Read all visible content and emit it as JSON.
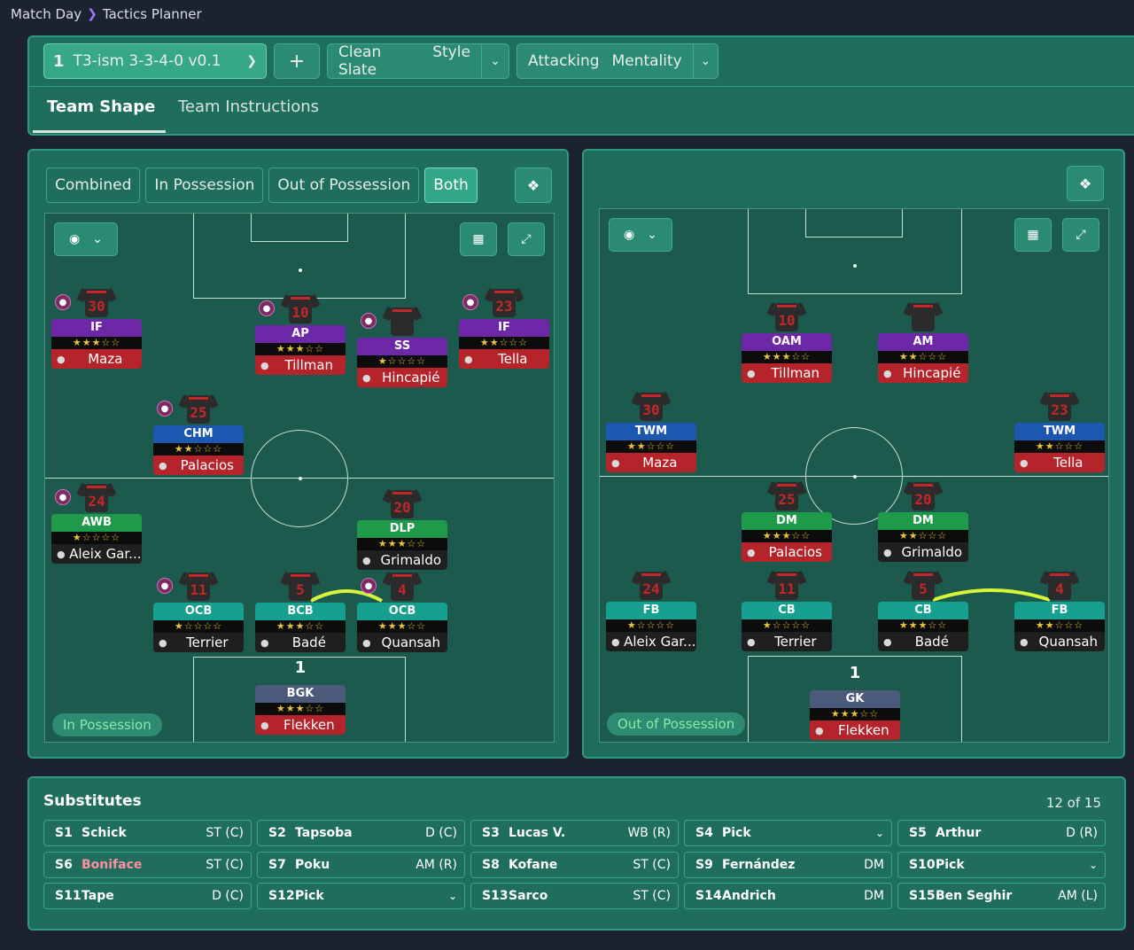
{
  "breadcrumb": {
    "root": "Match Day",
    "current": "Tactics Planner"
  },
  "toolbar": {
    "tactic_num": "1",
    "tactic_name": "T3-ism 3-3-4-0 v0.1",
    "add_label": "+",
    "style_value": "Clean Slate",
    "style_label": "Style",
    "mentality_value": "Attacking",
    "mentality_label": "Mentality"
  },
  "tabs": {
    "team_shape": "Team Shape",
    "team_instructions": "Team Instructions"
  },
  "view_toggle": {
    "combined": "Combined",
    "in_possession": "In Possession",
    "out_of_possession": "Out of Possession",
    "both": "Both"
  },
  "left_pitch": {
    "phase_label": "In Possession",
    "players": [
      {
        "role": "IF",
        "stars": "★★★☆☆",
        "name": "Maza",
        "shirt": "30"
      },
      {
        "role": "AP",
        "stars": "★★★☆☆",
        "name": "Tillman",
        "shirt": "10"
      },
      {
        "role": "SS",
        "stars": "★☆☆☆☆",
        "name": "Hincapié",
        "shirt": ""
      },
      {
        "role": "IF",
        "stars": "★★☆☆☆",
        "name": "Tella",
        "shirt": "23"
      },
      {
        "role": "CHM",
        "stars": "★★☆☆☆",
        "name": "Palacios",
        "shirt": "25"
      },
      {
        "role": "AWB",
        "stars": "★☆☆☆☆",
        "name": "Aleix Gar...",
        "shirt": "24"
      },
      {
        "role": "DLP",
        "stars": "★★★☆☆",
        "name": "Grimaldo",
        "shirt": "20"
      },
      {
        "role": "OCB",
        "stars": "★☆☆☆☆",
        "name": "Terrier",
        "shirt": "11"
      },
      {
        "role": "BCB",
        "stars": "★★★☆☆",
        "name": "Badé",
        "shirt": "5"
      },
      {
        "role": "OCB",
        "stars": "★★★☆☆",
        "name": "Quansah",
        "shirt": "4"
      },
      {
        "role": "BGK",
        "stars": "★★★☆☆",
        "name": "Flekken",
        "shirt": "1"
      }
    ]
  },
  "right_pitch": {
    "phase_label": "Out of Possession",
    "players": [
      {
        "role": "OAM",
        "stars": "★★★☆☆",
        "name": "Tillman",
        "shirt": "10"
      },
      {
        "role": "AM",
        "stars": "★★☆☆☆",
        "name": "Hincapié",
        "shirt": ""
      },
      {
        "role": "TWM",
        "stars": "★★☆☆☆",
        "name": "Maza",
        "shirt": "30"
      },
      {
        "role": "TWM",
        "stars": "★★☆☆☆",
        "name": "Tella",
        "shirt": "23"
      },
      {
        "role": "DM",
        "stars": "★★★☆☆",
        "name": "Palacios",
        "shirt": "25"
      },
      {
        "role": "DM",
        "stars": "★★☆☆☆",
        "name": "Grimaldo",
        "shirt": "20"
      },
      {
        "role": "FB",
        "stars": "★☆☆☆☆",
        "name": "Aleix Gar...",
        "shirt": "24"
      },
      {
        "role": "CB",
        "stars": "★☆☆☆☆",
        "name": "Terrier",
        "shirt": "11"
      },
      {
        "role": "CB",
        "stars": "★★★☆☆",
        "name": "Badé",
        "shirt": "5"
      },
      {
        "role": "FB",
        "stars": "★★☆☆☆",
        "name": "Quansah",
        "shirt": "4"
      },
      {
        "role": "GK",
        "stars": "★★★☆☆",
        "name": "Flekken",
        "shirt": "1"
      }
    ]
  },
  "substitutes": {
    "title": "Substitutes",
    "count": "12 of 15",
    "items": [
      {
        "code": "S1",
        "name": "Schick",
        "pos": "ST (C)"
      },
      {
        "code": "S2",
        "name": "Tapsoba",
        "pos": "D (C)"
      },
      {
        "code": "S3",
        "name": "Lucas V.",
        "pos": "WB (R)"
      },
      {
        "code": "S4",
        "name": "Pick",
        "pos": ""
      },
      {
        "code": "S5",
        "name": "Arthur",
        "pos": "D (R)"
      },
      {
        "code": "S6",
        "name": "Boniface",
        "pos": "ST (C)"
      },
      {
        "code": "S7",
        "name": "Poku",
        "pos": "AM (R)"
      },
      {
        "code": "S8",
        "name": "Kofane",
        "pos": "ST (C)"
      },
      {
        "code": "S9",
        "name": "Fernández",
        "pos": "DM"
      },
      {
        "code": "S10",
        "name": "Pick",
        "pos": ""
      },
      {
        "code": "S11",
        "name": "Tape",
        "pos": "D (C)"
      },
      {
        "code": "S12",
        "name": "Pick",
        "pos": ""
      },
      {
        "code": "S13",
        "name": "Sarco",
        "pos": "ST (C)"
      },
      {
        "code": "S14",
        "name": "Andrich",
        "pos": "DM"
      },
      {
        "code": "S15",
        "name": "Ben Seghir",
        "pos": "AM (L)"
      }
    ]
  }
}
